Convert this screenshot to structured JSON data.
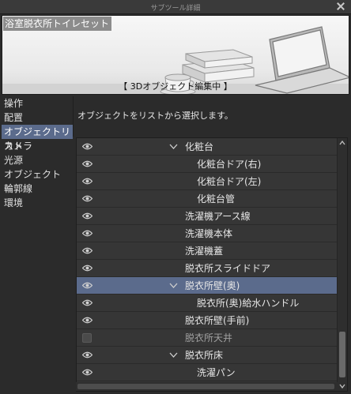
{
  "window": {
    "title": "サブツール詳細"
  },
  "preview": {
    "preset_name": "浴室脱衣所トイレセット",
    "mode_label": "【 3Dオブジェクト編集中 】"
  },
  "menu": {
    "items": [
      {
        "label": "操作",
        "active": false
      },
      {
        "label": "配置",
        "active": false
      },
      {
        "label": "オブジェクトリスト",
        "active": true
      },
      {
        "label": "カメラ",
        "active": false
      },
      {
        "label": "光源",
        "active": false
      },
      {
        "label": "オブジェクト",
        "active": false
      },
      {
        "label": "輪郭線",
        "active": false
      },
      {
        "label": "環境",
        "active": false
      }
    ]
  },
  "description": "オブジェクトをリストから選択します。",
  "object_list": {
    "rows": [
      {
        "label": "化粧台",
        "visible": true,
        "expanded": true,
        "indent": 1,
        "selected": false
      },
      {
        "label": "化粧台ドア(右)",
        "visible": true,
        "indent": 2,
        "selected": false
      },
      {
        "label": "化粧台ドア(左)",
        "visible": true,
        "indent": 2,
        "selected": false
      },
      {
        "label": "化粧台管",
        "visible": true,
        "indent": 2,
        "selected": false
      },
      {
        "label": "洗濯機アース線",
        "visible": true,
        "indent": 1,
        "selected": false
      },
      {
        "label": "洗濯機本体",
        "visible": true,
        "indent": 1,
        "selected": false
      },
      {
        "label": "洗濯機蓋",
        "visible": true,
        "indent": 1,
        "selected": false
      },
      {
        "label": "脱衣所スライドドア",
        "visible": true,
        "indent": 1,
        "selected": false
      },
      {
        "label": "脱衣所壁(奥)",
        "visible": true,
        "expanded": true,
        "indent": 1,
        "selected": true
      },
      {
        "label": "脱衣所(奥)給水ハンドル",
        "visible": true,
        "indent": 2,
        "selected": false
      },
      {
        "label": "脱衣所壁(手前)",
        "visible": true,
        "indent": 1,
        "selected": false
      },
      {
        "label": "脱衣所天井",
        "visible": false,
        "indent": 1,
        "selected": false
      },
      {
        "label": "脱衣所床",
        "visible": true,
        "expanded": true,
        "indent": 1,
        "selected": false
      },
      {
        "label": "洗濯パン",
        "visible": true,
        "indent": 2,
        "selected": false
      }
    ]
  },
  "icons": {
    "visible": "eye-icon",
    "hidden": "visibility-off-checkbox",
    "expand": "chevron-down-icon",
    "close": "close-icon"
  },
  "colors": {
    "selection": "#5b6b8c",
    "panel": "#2b2b2b",
    "list_bg": "#363636"
  }
}
